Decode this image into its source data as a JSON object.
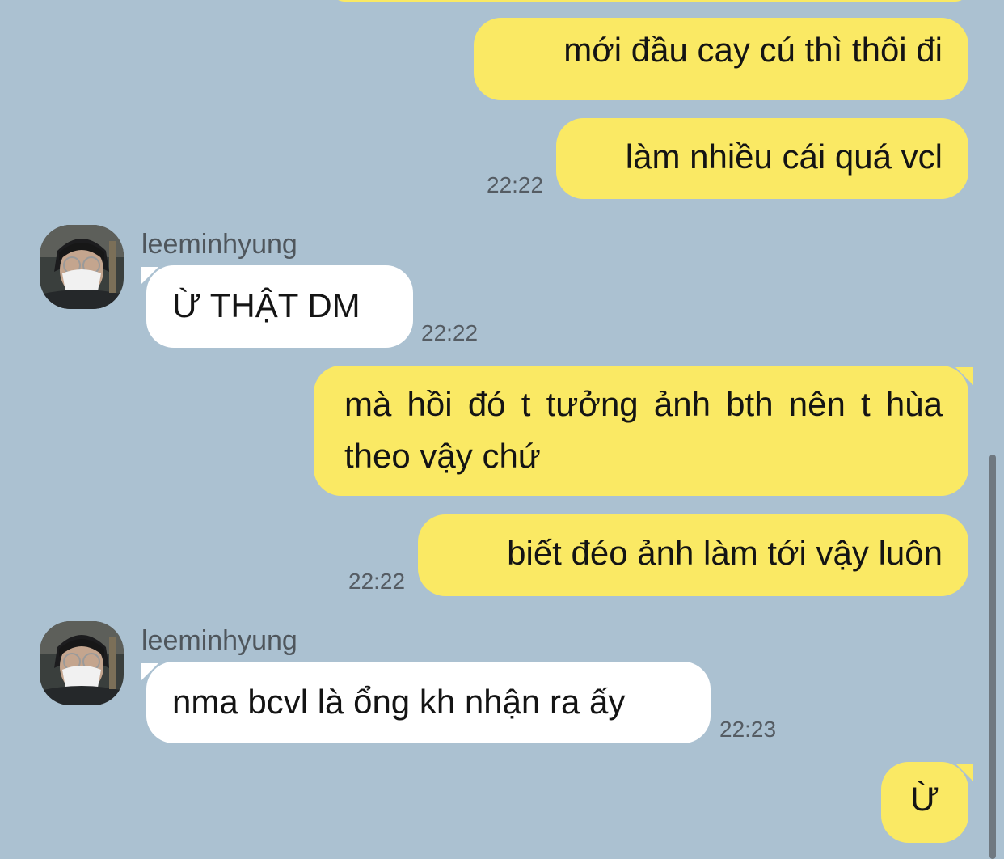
{
  "colors": {
    "background": "#abc1d1",
    "outgoing_bubble": "#fae964",
    "incoming_bubble": "#ffffff",
    "timestamp_text": "#555c63",
    "sender_text": "#4f565c"
  },
  "messages": [
    {
      "type": "outgoing",
      "text": "mới đầu cay cú thì thôi đi",
      "time": ""
    },
    {
      "type": "outgoing",
      "text": "làm nhiều cái quá vcl",
      "time": "22:22"
    },
    {
      "type": "incoming",
      "sender": "leeminhyung",
      "text": "Ừ THẬT DM",
      "time": "22:22",
      "avatar_icon": "user-avatar-photo"
    },
    {
      "type": "outgoing",
      "text": "mà hồi đó t tưởng ảnh bth nên t hùa theo vậy chứ",
      "time": ""
    },
    {
      "type": "outgoing",
      "text": "biết đéo ảnh làm tới vậy luôn",
      "time": "22:22"
    },
    {
      "type": "incoming",
      "sender": "leeminhyung",
      "text": "nma bcvl là ổng kh nhận ra ấy",
      "time": "22:23",
      "avatar_icon": "user-avatar-photo"
    },
    {
      "type": "outgoing",
      "text": "Ừ",
      "time": ""
    }
  ]
}
